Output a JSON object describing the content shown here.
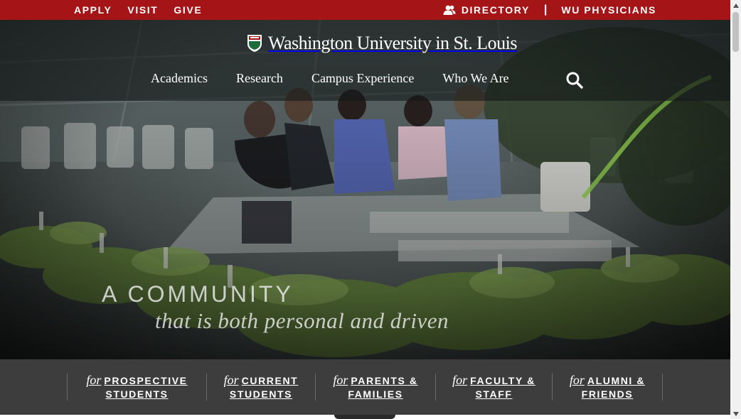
{
  "utility_nav": {
    "left": [
      "APPLY",
      "VISIT",
      "GIVE"
    ],
    "directory": "DIRECTORY",
    "separator": "|",
    "physicians": "WU PHYSICIANS"
  },
  "header": {
    "logo_text": "Washington University in St. Louis",
    "nav": [
      "Academics",
      "Research",
      "Campus Experience",
      "Who We Are"
    ]
  },
  "hero": {
    "tagline_line1": "A COMMUNITY",
    "tagline_line2": "that is both personal and driven"
  },
  "audience": [
    {
      "for": "for",
      "line1": "PROSPECTIVE",
      "line2": "STUDENTS"
    },
    {
      "for": "for",
      "line1": "CURRENT",
      "line2": "STUDENTS"
    },
    {
      "for": "for",
      "line1": "PARENTS &",
      "line2": "FAMILIES"
    },
    {
      "for": "for",
      "line1": "FACULTY &",
      "line2": "STAFF"
    },
    {
      "for": "for",
      "line1": "ALUMNI &",
      "line2": "FRIENDS"
    }
  ],
  "colors": {
    "brand_red": "#a51417",
    "audience_bar": "#3d3d3d"
  },
  "icons": {
    "directory": "people-icon",
    "search": "search-icon",
    "logo": "shield-icon"
  }
}
